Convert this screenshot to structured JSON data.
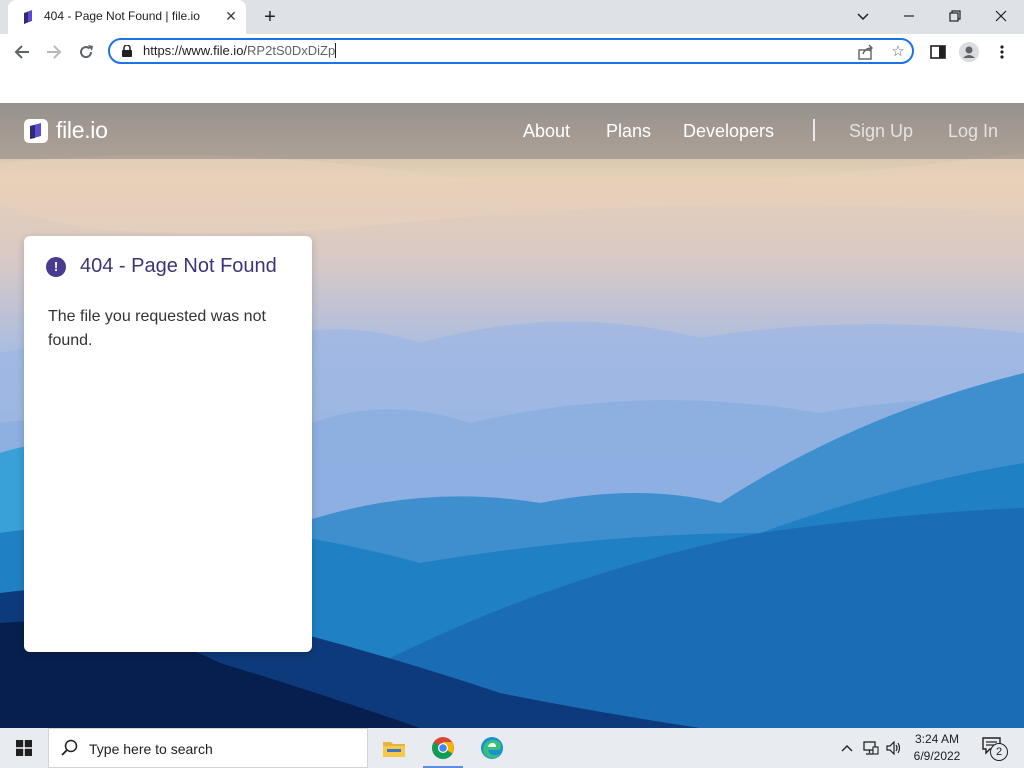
{
  "browser": {
    "tab_title": "404 - Page Not Found | file.io",
    "url_host": "https://www.file.io/",
    "url_path": "RP2tS0DxDiZp"
  },
  "site": {
    "logo_text": "file.io",
    "nav": [
      "About",
      "Plans",
      "Developers"
    ],
    "auth": [
      "Sign Up",
      "Log In"
    ]
  },
  "card": {
    "title": "404 - Page Not Found",
    "message": "The file you requested was not found."
  },
  "taskbar": {
    "search_placeholder": "Type here to search",
    "time": "3:24 AM",
    "date": "6/9/2022",
    "notification_count": "2"
  },
  "colors": {
    "accent": "#1a73e8",
    "brand_purple": "#4b3b8f",
    "card_title": "#3b3578"
  }
}
